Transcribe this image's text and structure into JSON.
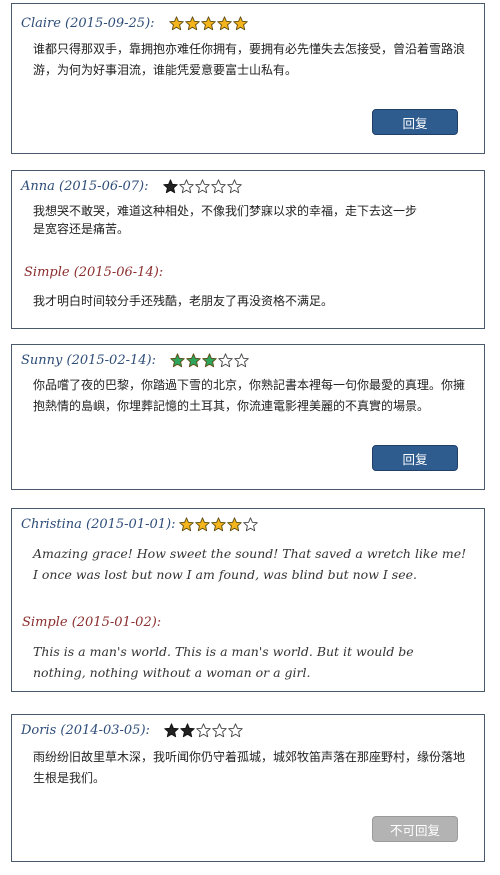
{
  "colors": {
    "star_gold": "#f3b41c",
    "star_green": "#2fa35a",
    "star_dark": "#222222",
    "button_active": "#2f5c8f",
    "button_disabled": "#b3b3b3",
    "author": "#2e4d78",
    "reply_author": "#8c2e2e"
  },
  "reviews": [
    {
      "author": "Claire (2015-09-25):",
      "rating": 5,
      "star_style": "gold",
      "text": "谁都只得那双手，靠拥抱亦难任你拥有，要拥有必先懂失去怎接受，曾沿着雪路浪游，为何为好事泪流，谁能凭爱意要富士山私有。",
      "button": "回复"
    },
    {
      "author": "Anna (2015-06-07):",
      "rating": 1,
      "star_style": "dark",
      "text": "我想哭不敢哭，难道这种相处，不像我们梦寐以求的幸福，走下去这一步是宽容还是痛苦。",
      "reply_author": "Simple (2015-06-14):",
      "reply_text": "我才明白时间较分手还残酷，老朋友了再没资格不满足。"
    },
    {
      "author": "Sunny (2015-02-14):",
      "rating": 3,
      "star_style": "green",
      "text": "你品嚐了夜的巴黎，你踏過下雪的北京，你熟記書本裡每一句你最愛的真理。你擁抱熱情的島嶼，你埋葬記憶的土耳其，你流連電影裡美麗的不真實的場景。",
      "button": "回复"
    },
    {
      "author": "Christina (2015-01-01):",
      "rating": 4,
      "star_style": "gold",
      "text": "Amazing grace! How sweet the sound! That saved a wretch like me! I once was lost but now I am found, was blind but now I see.",
      "reply_author": "Simple (2015-01-02):",
      "reply_text": "This is a man's world. This is a man's world. But it would be nothing, nothing without a woman or a girl."
    },
    {
      "author": "Doris (2014-03-05):",
      "rating": 2,
      "star_style": "dark",
      "text": "雨纷纷旧故里草木深，我听闻你仍守着孤城，城郊牧笛声落在那座野村，缘份落地生根是我们。",
      "button": "不可回复"
    }
  ]
}
